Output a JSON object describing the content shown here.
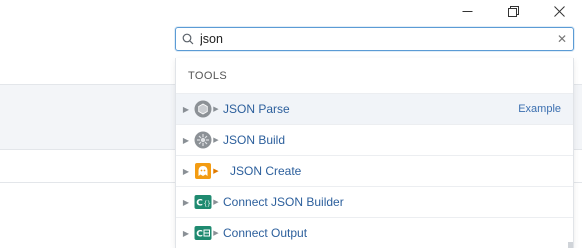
{
  "window_controls": {
    "minimize_icon": "minimize-icon",
    "restore_icon": "restore-icon",
    "close_icon": "close-icon"
  },
  "search": {
    "value": "json",
    "icon": "search-icon",
    "clear_icon": "clear-icon"
  },
  "dropdown": {
    "section_title": "TOOLS",
    "items": [
      {
        "label": "JSON Parse",
        "icon": "json-parse-icon",
        "hint": "Example",
        "active": true
      },
      {
        "label": "JSON Build",
        "icon": "json-build-icon",
        "hint": ""
      },
      {
        "label": "JSON Create",
        "icon": "json-create-icon",
        "hint": ""
      },
      {
        "label": "Connect JSON Builder",
        "icon": "connect-json-builder-icon",
        "hint": ""
      },
      {
        "label": "Connect Output",
        "icon": "connect-output-icon",
        "hint": ""
      }
    ]
  },
  "colors": {
    "accent": "#5b9bd5",
    "link": "#2c5f9c",
    "gray_tool": "#8c9196",
    "orange_tool": "#f39c12",
    "teal_tool": "#1f8a70"
  }
}
